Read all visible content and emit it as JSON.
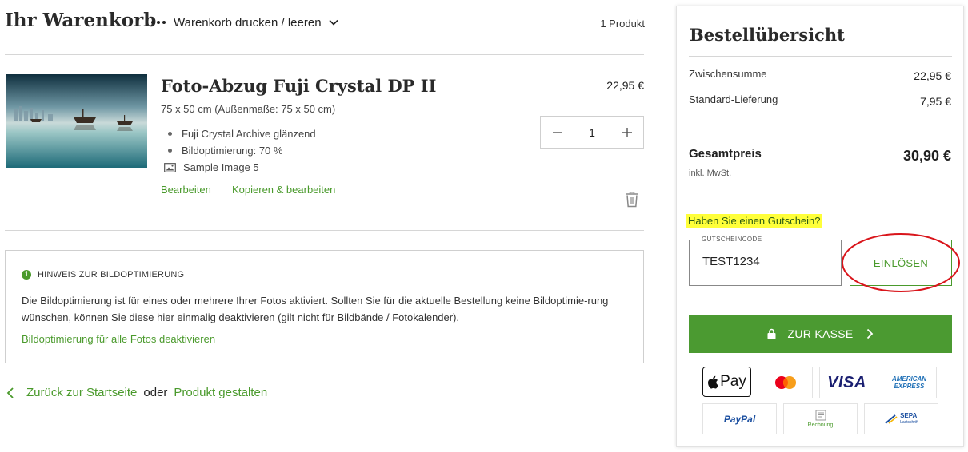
{
  "cart": {
    "title": "Ihr Warenkorb",
    "print_clear_label": "Warenkorb drucken / leeren",
    "product_count": "1 Produkt"
  },
  "item": {
    "title": "Foto-Abzug Fuji Crystal DP II",
    "size": "75 x 50 cm (Außenmaße: 75 x 50 cm)",
    "specs": [
      "Fuji Crystal Archive glänzend",
      "Bildoptimierung: 70 %"
    ],
    "image_name": "Sample Image 5",
    "edit_link": "Bearbeiten",
    "copy_edit_link": "Kopieren & bearbeiten",
    "price": "22,95 €",
    "quantity": "1"
  },
  "note": {
    "title": "HINWEIS ZUR BILDOPTIMIERUNG",
    "body": "Die Bildoptimierung ist für eines oder mehrere Ihrer Fotos aktiviert. Sollten Sie für die aktuelle Bestellung keine Bildoptimie-rung wünschen, können Sie diese hier einmalig deaktivieren (gilt nicht für Bildbände / Fotokalender).",
    "link": "Bildoptimierung für alle Fotos deaktivieren"
  },
  "footer": {
    "back_link": "Zurück zur Startseite",
    "or": "oder",
    "design_link": "Produkt gestalten"
  },
  "summary": {
    "title": "Bestellübersicht",
    "subtotal_label": "Zwischensumme",
    "subtotal_value": "22,95 €",
    "shipping_label": "Standard-Lieferung",
    "shipping_value": "7,95 €",
    "total_label": "Gesamtpreis",
    "total_value": "30,90 €",
    "vat_note": "inkl. MwSt.",
    "voucher_question": "Haben Sie einen Gutschein?",
    "coupon_label": "GUTSCHEINCODE",
    "coupon_value": "TEST1234",
    "redeem_label": "EINLÖSEN",
    "checkout_label": "ZUR KASSE"
  },
  "payment_methods": {
    "applepay": "Pay",
    "visa": "VISA",
    "amex_line1": "AMERICAN",
    "amex_line2": "EXPRESS",
    "paypal": "PayPal",
    "invoice": "Rechnung",
    "sepa_line1": "SEPA",
    "sepa_line2": "Lastschrift"
  },
  "colors": {
    "accent_green": "#4b9a31",
    "highlight_yellow": "#ffff3a",
    "annotation_red": "#d9151b"
  }
}
